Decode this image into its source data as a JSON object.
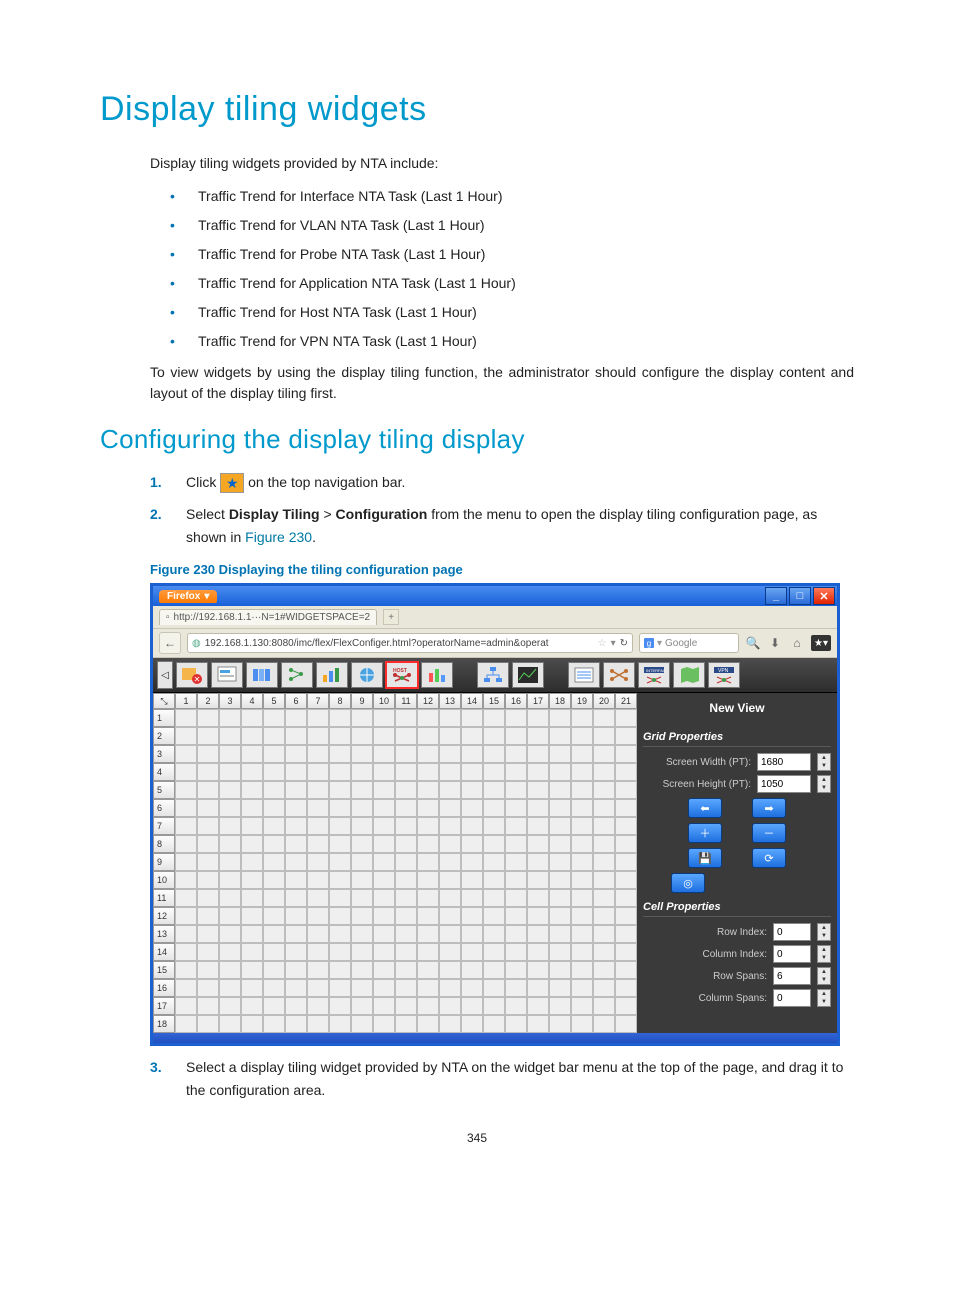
{
  "page_number": "345",
  "h1": "Display tiling widgets",
  "intro": "Display tiling widgets provided by NTA include:",
  "widgets": [
    "Traffic Trend for Interface NTA Task (Last 1 Hour)",
    "Traffic Trend for VLAN NTA Task (Last 1 Hour)",
    "Traffic Trend for Probe NTA Task (Last 1 Hour)",
    "Traffic Trend for Application NTA Task (Last 1 Hour)",
    "Traffic Trend for Host NTA Task (Last 1 Hour)",
    "Traffic Trend for VPN NTA Task (Last 1 Hour)"
  ],
  "intro_after": "To view widgets by using the display tiling function, the administrator should configure the display content and layout of the display tiling first.",
  "h2": "Configuring the display tiling display",
  "steps": {
    "s1a": "Click ",
    "s1b": " on the top navigation bar.",
    "s2a": "Select ",
    "s2b": "Display Tiling",
    "s2c": " > ",
    "s2d": "Configuration",
    "s2e": " from the menu to open the display tiling configuration page, as shown in ",
    "s2f": "Figure 230",
    "s2g": ".",
    "s3": "Select a display tiling widget provided by NTA on the widget bar menu at the top of the page, and drag it to the configuration area."
  },
  "figure_caption": "Figure 230 Displaying the tiling configuration page",
  "browser": {
    "firefox_label": "Firefox",
    "tab_title": "http://192.168.1.1···N=1#WIDGETSPACE=2",
    "url": "192.168.1.130:8080/imc/flex/FlexConfiger.html?operatorName=admin&operat",
    "search_placeholder": "Google"
  },
  "panel": {
    "title": "New View",
    "grid_section": "Grid Properties",
    "screen_w_label": "Screen Width (PT):",
    "screen_w_value": "1680",
    "screen_h_label": "Screen Height (PT):",
    "screen_h_value": "1050",
    "cell_section": "Cell Properties",
    "row_idx_label": "Row Index:",
    "row_idx_value": "0",
    "col_idx_label": "Column Index:",
    "col_idx_value": "0",
    "row_span_label": "Row Spans:",
    "row_span_value": "6",
    "col_span_label": "Column Spans:",
    "col_span_value": "0"
  },
  "grid": {
    "cols": [
      "1",
      "2",
      "3",
      "4",
      "5",
      "6",
      "7",
      "8",
      "9",
      "10",
      "11",
      "12",
      "13",
      "14",
      "15",
      "16",
      "17",
      "18",
      "19",
      "20",
      "21"
    ],
    "rows": [
      "1",
      "2",
      "3",
      "4",
      "5",
      "6",
      "7",
      "8",
      "9",
      "10",
      "11",
      "12",
      "13",
      "14",
      "15",
      "16",
      "17",
      "18"
    ]
  },
  "toolbar_items": [
    "alert",
    "clipboard",
    "columns",
    "tree",
    "bars",
    "globe",
    "host",
    "chart",
    "spacer",
    "topo",
    "graph",
    "spacer2",
    "list",
    "node",
    "interface",
    "map",
    "vpn"
  ]
}
